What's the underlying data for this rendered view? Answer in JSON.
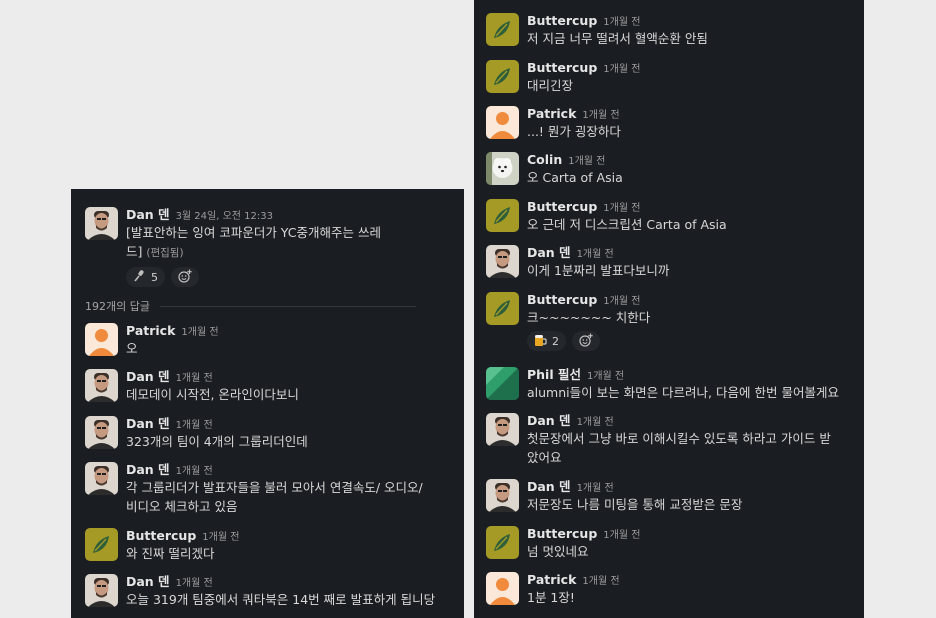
{
  "thread": {
    "parent": {
      "author": "Dan 덴",
      "time": "3월 24일, 오전 12:33",
      "text_line1": "[발표안하는 잉여 코파운더가 YC중개해주는 쓰레",
      "text_line2": "드]",
      "edited": "(편집됨)",
      "reaction_count": "5"
    },
    "reply_count_label": "192개의 답글",
    "left_messages": [
      {
        "author": "Patrick",
        "time": "1개월 전",
        "lines": [
          "오"
        ]
      },
      {
        "author": "Dan 덴",
        "time": "1개월 전",
        "lines": [
          "데모데이 시작전, 온라인이다보니"
        ]
      },
      {
        "author": "Dan 덴",
        "time": "1개월 전",
        "lines": [
          "323개의 팀이 4개의 그룹리더인데"
        ]
      },
      {
        "author": "Dan 덴",
        "time": "1개월 전",
        "lines": [
          "각 그룹리더가 발표자들을 불러 모아서 연결속도/ 오디오/",
          "비디오 체크하고 있음"
        ]
      },
      {
        "author": "Buttercup",
        "time": "1개월 전",
        "lines": [
          "와 진짜 떨리겠다"
        ]
      },
      {
        "author": "Dan 덴",
        "time": "1개월 전",
        "lines": [
          "오늘 319개 팀중에서 쿼타북은 14번 째로 발표하게 됩니당"
        ]
      }
    ],
    "right_messages": [
      {
        "author": "Buttercup",
        "time": "1개월 전",
        "lines": [
          "저 지금 너무 떨려서 혈액순환 안됨"
        ]
      },
      {
        "author": "Buttercup",
        "time": "1개월 전",
        "lines": [
          "대리긴장"
        ]
      },
      {
        "author": "Patrick",
        "time": "1개월 전",
        "lines": [
          "...! 뭔가 굉장하다"
        ]
      },
      {
        "author": "Colin",
        "time": "1개월 전",
        "lines": [
          "오 Carta of Asia"
        ]
      },
      {
        "author": "Buttercup",
        "time": "1개월 전",
        "lines": [
          "오 근데 저 디스크립션 Carta of Asia"
        ]
      },
      {
        "author": "Dan 덴",
        "time": "1개월 전",
        "lines": [
          "이게 1분짜리 발표다보니까"
        ]
      },
      {
        "author": "Buttercup",
        "time": "1개월 전",
        "lines": [
          "크~~~~~~~ 치한다"
        ],
        "reaction_count": "2"
      },
      {
        "author": "Phil 필선",
        "time": "1개월 전",
        "lines": [
          "alumni들이 보는 화면은 다르려나, 다음에 한번 물어볼게요"
        ]
      },
      {
        "author": "Dan 덴",
        "time": "1개월 전",
        "lines": [
          "첫문장에서 그냥 바로 이해시킬수 있도록 하라고 가이드 받",
          "았어요"
        ]
      },
      {
        "author": "Dan 덴",
        "time": "1개월 전",
        "lines": [
          "저문장도 나름 미팅을 통해 교정받은 문장"
        ]
      },
      {
        "author": "Buttercup",
        "time": "1개월 전",
        "lines": [
          "넘 멋있네요"
        ]
      },
      {
        "author": "Patrick",
        "time": "1개월 전",
        "lines": [
          "1분 1장!"
        ]
      }
    ]
  },
  "icons": {
    "reaction_1": "microphone-icon",
    "reaction_2": "beer-mug-icon",
    "add_reaction": "add-reaction-icon"
  },
  "colors": {
    "panel_bg": "#1a1d21",
    "page_bg": "#ececec",
    "buttercup_avatar": "#a59a26",
    "patrick_avatar": "#f08a3c",
    "phil_avatar": "#2e9e6b"
  }
}
